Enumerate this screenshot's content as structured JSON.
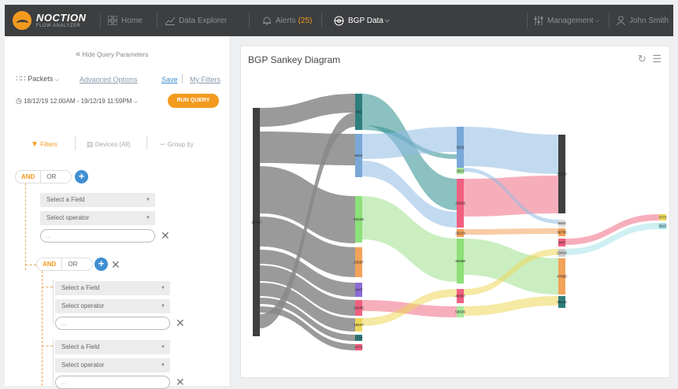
{
  "brand": {
    "name": "NOCTION",
    "tagline": "FLOW ANALYZER"
  },
  "nav": {
    "home": "Home",
    "data_explorer": "Data Explorer",
    "alerts": "Alerts",
    "alerts_count": "(25)",
    "bgp_data": "BGP Data",
    "management": "Management",
    "user": "John Smith"
  },
  "sidebar": {
    "hide_query": "Hide Query Parameters",
    "packets": "Packets",
    "advanced_options": "Advanced Options",
    "save": "Save",
    "my_filters": "My Filters",
    "date_range": "18/12/19 12:00AM - 19/12/19 11:59PM",
    "run_query": "RUN QUERY",
    "tabs": {
      "filters": "Filters",
      "devices": "Devices (All)",
      "group_by": "Group by"
    },
    "and_label": "AND",
    "or_label": "OR",
    "field_placeholder": "Select a Field",
    "operator_placeholder": "Select operator",
    "value_placeholder": "..."
  },
  "chart": {
    "title": "BGP Sankey Diagram"
  },
  "chart_data": {
    "type": "sankey",
    "title": "BGP Sankey Diagram",
    "nodes": [
      {
        "id": "src",
        "label": "25410",
        "color": "#3f3f3f"
      },
      {
        "id": "l1",
        "label": "891",
        "color": "#2e7e7e"
      },
      {
        "id": "l2",
        "label": "5424",
        "color": "#7aa8d8"
      },
      {
        "id": "l3",
        "label": "63238",
        "color": "#8ee07a"
      },
      {
        "id": "l4",
        "label": "23597",
        "color": "#f2a35a"
      },
      {
        "id": "l5",
        "label": "2447",
        "color": "#8b6bd4"
      },
      {
        "id": "l6",
        "label": "23265",
        "color": "#f06080"
      },
      {
        "id": "l7",
        "label": "16527",
        "color": "#ecd75a"
      },
      {
        "id": "l8",
        "label": "1724",
        "color": "#2e7e7e"
      },
      {
        "id": "l9",
        "label": "4779",
        "color": "#f06080"
      },
      {
        "id": "m1",
        "label": "3216",
        "color": "#7aa8d8"
      },
      {
        "id": "m2",
        "label": "2913",
        "color": "#a8e89a"
      },
      {
        "id": "m3",
        "label": "33153",
        "color": "#f06080"
      },
      {
        "id": "m4",
        "label": "25129",
        "color": "#f2a35a"
      },
      {
        "id": "m5",
        "label": "35468",
        "color": "#8ee07a"
      },
      {
        "id": "m6",
        "label": "40357",
        "color": "#f06080"
      },
      {
        "id": "m7",
        "label": "58336",
        "color": "#a8e89a"
      },
      {
        "id": "r1",
        "label": "17330",
        "color": "#3f3f3f"
      },
      {
        "id": "r2",
        "label": "9463",
        "color": "#dddddd"
      },
      {
        "id": "r3",
        "label": "36705",
        "color": "#f2a35a"
      },
      {
        "id": "r4",
        "label": "3457",
        "color": "#f06080"
      },
      {
        "id": "r5",
        "label": "23418",
        "color": "#cccccc"
      },
      {
        "id": "r6",
        "label": "47658",
        "color": "#f2a35a"
      },
      {
        "id": "r7",
        "label": "25124",
        "color": "#2e7e7e"
      },
      {
        "id": "f1",
        "label": "4773",
        "color": "#ecd75a"
      },
      {
        "id": "f2",
        "label": "5825",
        "color": "#a7e3e8"
      }
    ]
  }
}
